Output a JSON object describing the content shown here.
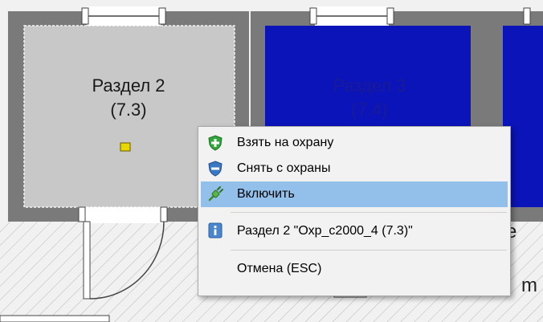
{
  "rooms": [
    {
      "id": "room2",
      "title": "Раздел 2",
      "code": "(7.3)",
      "color": "#c8c8c8"
    },
    {
      "id": "room3",
      "title": "Раздел 3",
      "code": "(7.4)",
      "color": "#0a14b8"
    }
  ],
  "floor_text": {
    "e": "e",
    "m": "m"
  },
  "context_menu": {
    "items": [
      {
        "label": "Взять на охрану",
        "icon": "shield-plus-icon"
      },
      {
        "label": "Снять с охраны",
        "icon": "shield-minus-icon"
      },
      {
        "label": "Включить",
        "icon": "plug-icon",
        "highlighted": true
      }
    ],
    "info_item": {
      "label": "Раздел 2  \"Охр_с2000_4 (7.3)\"",
      "icon": "info-icon"
    },
    "cancel_label": "Отмена (ESC)"
  },
  "colors": {
    "room_inactive": "#c8c8c8",
    "room_active": "#0a14b8",
    "menu_highlight": "#93c0ea",
    "indicator": "#e8d800"
  }
}
